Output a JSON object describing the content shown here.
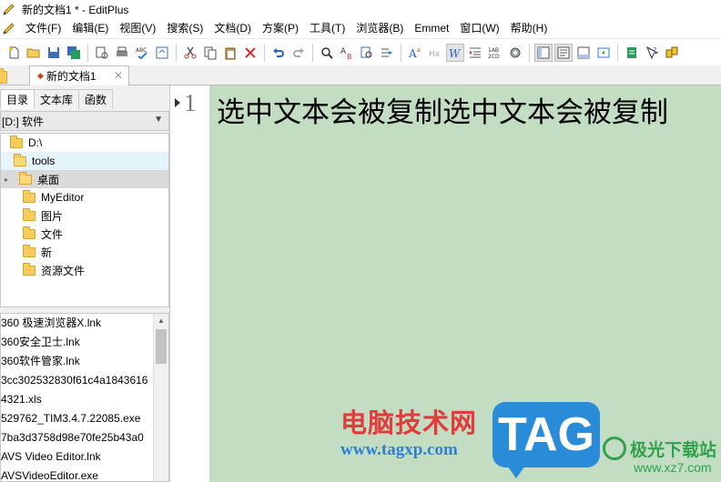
{
  "window": {
    "title": "新的文档1 * - EditPlus"
  },
  "menu": [
    "文件(F)",
    "编辑(E)",
    "视图(V)",
    "搜索(S)",
    "文档(D)",
    "方案(P)",
    "工具(T)",
    "浏览器(B)",
    "Emmet",
    "窗口(W)",
    "帮助(H)"
  ],
  "toolbar": {
    "buttons": [
      "new-icon",
      "open-icon",
      "save-icon",
      "save-all-icon",
      "print-preview-icon",
      "print-icon",
      "spellcheck-icon",
      "browser-preview-icon",
      "cut-icon",
      "copy-icon",
      "paste-icon",
      "delete-icon",
      "undo-icon",
      "redo-icon",
      "find-icon",
      "replace-icon",
      "find-in-files-icon",
      "goto-line-icon",
      "font-icon",
      "hex-icon",
      "word-wrap-icon",
      "indent-icon",
      "ruler-icon",
      "settings-icon",
      "directory-window-icon",
      "cliptext-window-icon",
      "output-window-icon",
      "fullscreen-icon",
      "user-tool-icon",
      "help-icon",
      "plugin-icon"
    ]
  },
  "doc_tab": {
    "label": "新的文档1",
    "modified_marker": "◆",
    "close": "✕"
  },
  "panel": {
    "tabs": [
      "目录",
      "文本库",
      "函数"
    ],
    "active_tab": "目录",
    "drive": "[D:] 软件",
    "tree": [
      {
        "label": "D:\\",
        "state": "normal"
      },
      {
        "label": "tools",
        "state": "hover"
      },
      {
        "label": "桌面",
        "state": "selected"
      },
      {
        "label": "MyEditor",
        "state": "normal"
      },
      {
        "label": "图片",
        "state": "normal"
      },
      {
        "label": "文件",
        "state": "normal"
      },
      {
        "label": "新",
        "state": "normal"
      },
      {
        "label": "资源文件",
        "state": "normal"
      }
    ],
    "files": [
      "360 极速浏览器X.lnk",
      "360安全卫士.lnk",
      "360软件管家.lnk",
      "3cc302532830f61c4a1843616",
      "4321.xls",
      "529762_TIM3.4.7.22085.exe",
      "7ba3d3758d98e70fe25b43a0",
      "AVS Video Editor.lnk",
      "AVSVideoEditor.exe"
    ]
  },
  "editor": {
    "line_number": "1",
    "text": "选中文本会被复制选中文本会被复制",
    "background": "#c3ddc3"
  },
  "watermark": {
    "site_name": "电脑技术网",
    "url": "www.tagxp.com",
    "tag": "TAG",
    "logo_name": "极光下载站",
    "logo_url": "www.xz7.com"
  }
}
